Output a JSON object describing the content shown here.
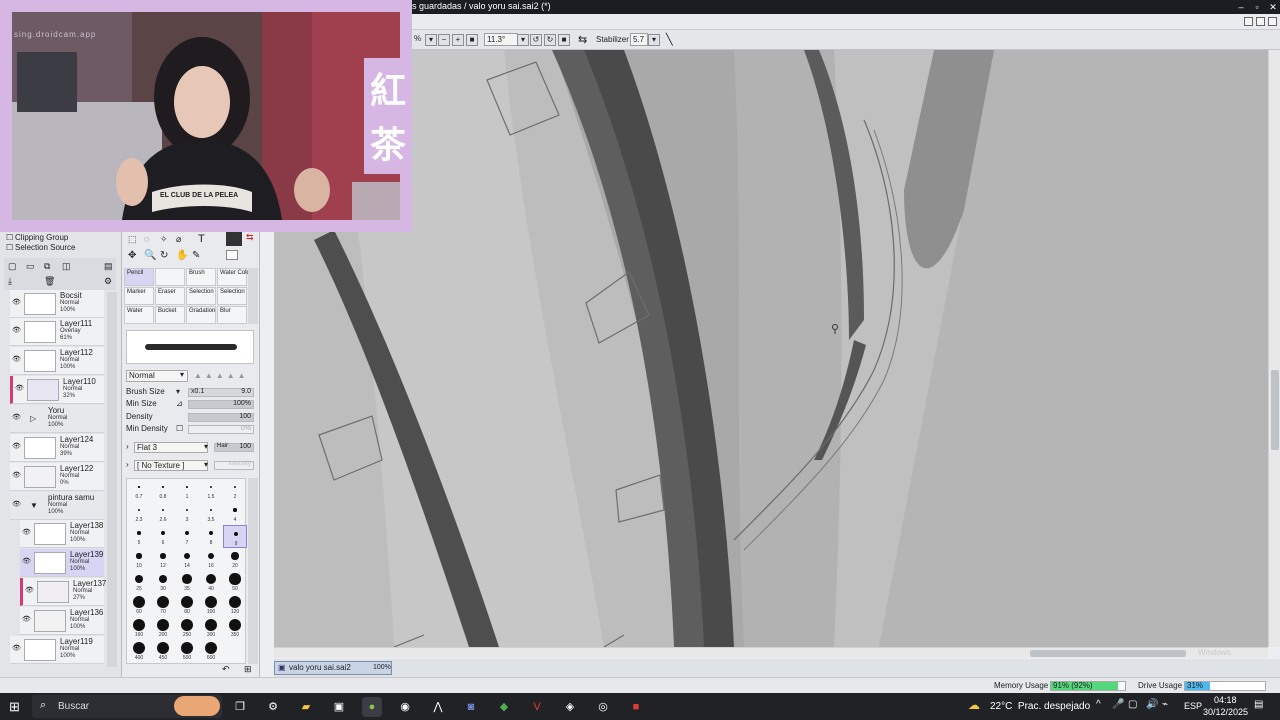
{
  "window": {
    "title": "s guardadas / valo yoru sai.sai2 (*)",
    "min_glyph": "–",
    "max_glyph": "▫",
    "close_glyph": "✕"
  },
  "toolbar": {
    "zoom_partial": "%",
    "rotation": "11.3°",
    "stabilizer_label": "Stabilizer",
    "stabilizer_value": "5.7"
  },
  "webcam": {
    "watermark": "sing.droidcam.app",
    "shirt_text": "EL CLUB DE LA PELEA",
    "kanji": [
      "紅",
      "茶"
    ]
  },
  "layer_panel": {
    "clipping_group": "Clipping Group",
    "selection_source": "Selection Source",
    "layers": [
      {
        "name": "Bocsit",
        "mode": "Normal",
        "opacity": "100%"
      },
      {
        "name": "Layer111",
        "mode": "Overlay",
        "opacity": "61%"
      },
      {
        "name": "Layer112",
        "mode": "Normal",
        "opacity": "100%"
      },
      {
        "name": "Layer110",
        "mode": "Normal",
        "opacity": "32%"
      },
      {
        "name": "Yoru",
        "mode": "Normal",
        "opacity": "100%"
      },
      {
        "name": "Layer124",
        "mode": "Normal",
        "opacity": "39%"
      },
      {
        "name": "Layer122",
        "mode": "Normal",
        "opacity": "0%"
      },
      {
        "name": "pintura samu",
        "mode": "Normal",
        "opacity": "100%"
      },
      {
        "name": "Layer138",
        "mode": "Normal",
        "opacity": "100%"
      },
      {
        "name": "Layer139",
        "mode": "Normal",
        "opacity": "100%"
      },
      {
        "name": "Layer137",
        "mode": "Normal",
        "opacity": "27%"
      },
      {
        "name": "Layer136",
        "mode": "Normal",
        "opacity": "100%"
      },
      {
        "name": "Layer119",
        "mode": "Normal",
        "opacity": "100%"
      }
    ]
  },
  "tools": {
    "brushes": [
      "Pencil",
      "",
      "Brush",
      "Water Color",
      "Marker",
      "Eraser",
      "Selection",
      "Selection",
      "Water",
      "Bucket",
      "Gradation",
      "Blur"
    ],
    "blend_mode": "Normal",
    "brush_size_label": "Brush Size",
    "brush_size_mult": "x0.1",
    "brush_size_value": "9.0",
    "min_size_label": "Min Size",
    "min_size_value": "100%",
    "density_label": "Density",
    "density_value": "100",
    "min_density_label": "Min Density",
    "min_density_value": "0%",
    "shape": "Flat 3",
    "shape_value": "100",
    "shape_hair": "Hair",
    "texture": "[ No Texture ]",
    "texture_value": "Intensity"
  },
  "brush_sizes": [
    "0.7",
    "0.8",
    "1",
    "1.5",
    "2",
    "2.3",
    "2.6",
    "3",
    "3.5",
    "4",
    "5",
    "6",
    "7",
    "8",
    "9",
    "10",
    "12",
    "14",
    "16",
    "20",
    "25",
    "30",
    "35",
    "40",
    "50",
    "60",
    "70",
    "80",
    "100",
    "120",
    "160",
    "200",
    "250",
    "300",
    "350",
    "400",
    "450",
    "500",
    "600"
  ],
  "navigator": {
    "file": "valo yoru sai.sai2",
    "zoom": "100%"
  },
  "status": {
    "memory_label": "Memory Usage",
    "memory_value": "91% (92%)",
    "memory_fraction": 0.91,
    "drive_label": "Drive Usage",
    "drive_value": "31%",
    "drive_fraction": 0.31,
    "watermark": "Windows."
  },
  "taskbar": {
    "search_placeholder": "Buscar",
    "weather": "22°C  Prac. despejado",
    "lang": "ESP",
    "time": "04:18",
    "date": "30/12/2025"
  }
}
